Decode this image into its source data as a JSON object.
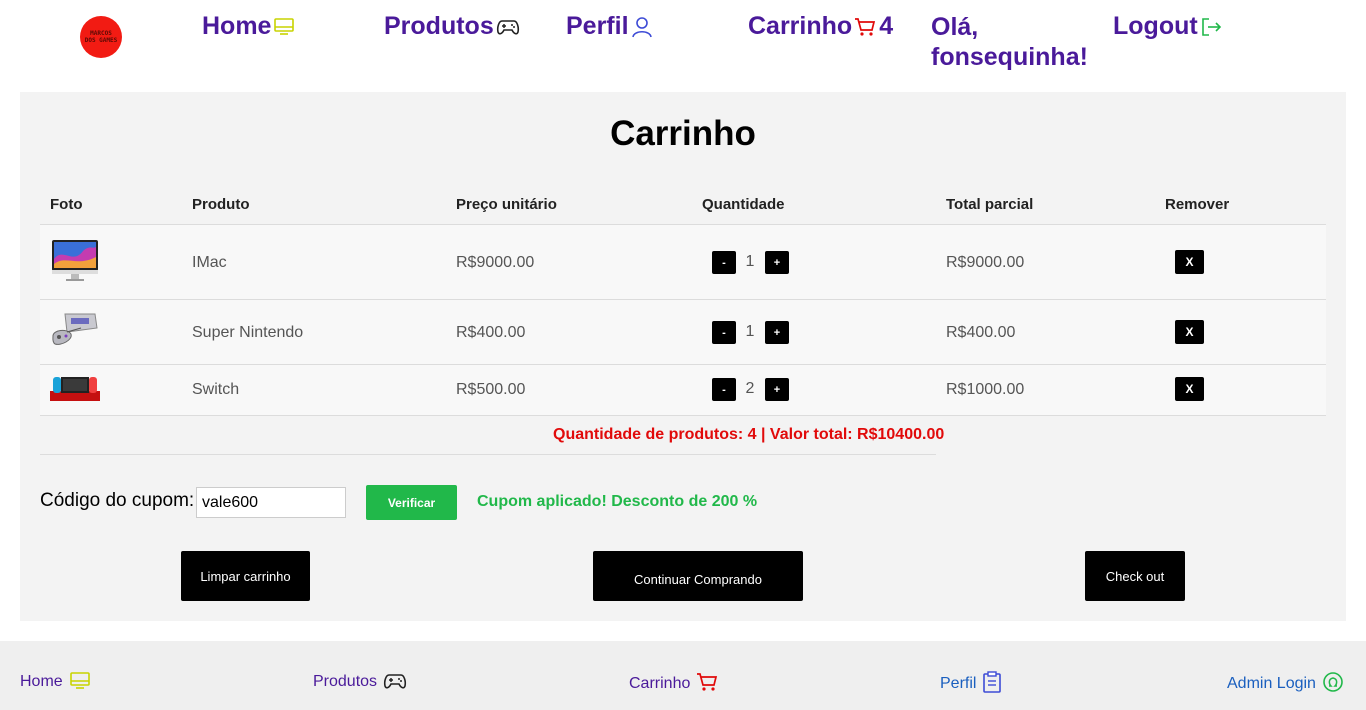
{
  "colors": {
    "brand_purple": "#4a1a9a",
    "danger_red": "#e10a0a",
    "success_green": "#21b84a",
    "panel_bg": "#f3f3f3"
  },
  "header": {
    "logo_text": [
      "MARCOS",
      "DOS GAMES"
    ],
    "nav": {
      "home": "Home",
      "produtos": "Produtos",
      "perfil": "Perfil",
      "carrinho": "Carrinho",
      "cart_count": "4",
      "greeting": "Olá, fonsequinha!",
      "logout": "Logout"
    },
    "icons": {
      "home": "monitor-icon",
      "produtos": "gamepad-icon",
      "perfil": "user-icon",
      "carrinho": "cart-icon",
      "logout": "logout-icon"
    }
  },
  "cart": {
    "title": "Carrinho",
    "columns": {
      "foto": "Foto",
      "produto": "Produto",
      "preco": "Preço unitário",
      "quantidade": "Quantidade",
      "total": "Total parcial",
      "remover": "Remover"
    },
    "items": [
      {
        "name": "IMac",
        "price": "R$9000.00",
        "qty": "1",
        "subtotal": "R$9000.00",
        "thumb": "imac-thumbnail"
      },
      {
        "name": "Super Nintendo",
        "price": "R$400.00",
        "qty": "1",
        "subtotal": "R$400.00",
        "thumb": "snes-thumbnail"
      },
      {
        "name": "Switch",
        "price": "R$500.00",
        "qty": "2",
        "subtotal": "R$1000.00",
        "thumb": "switch-thumbnail"
      }
    ],
    "buttons": {
      "minus": "-",
      "plus": "+",
      "remove": "X"
    },
    "summary": "Quantidade de produtos: 4 | Valor total: R$10400.00"
  },
  "coupon": {
    "label": "Código do cupom:",
    "value": "vale600",
    "verify_label": "Verificar",
    "message": "Cupom aplicado! Desconto de 200 %"
  },
  "actions": {
    "clear": "Limpar carrinho",
    "continue": "Continuar Comprando",
    "checkout": "Check out"
  },
  "footer": {
    "home": "Home",
    "produtos": "Produtos",
    "carrinho": "Carrinho",
    "perfil": "Perfil",
    "admin": "Admin Login",
    "icons": {
      "home": "monitor-icon",
      "produtos": "gamepad-icon",
      "carrinho": "cart-icon",
      "perfil": "clipboard-icon",
      "admin": "omega-circle-icon"
    }
  }
}
